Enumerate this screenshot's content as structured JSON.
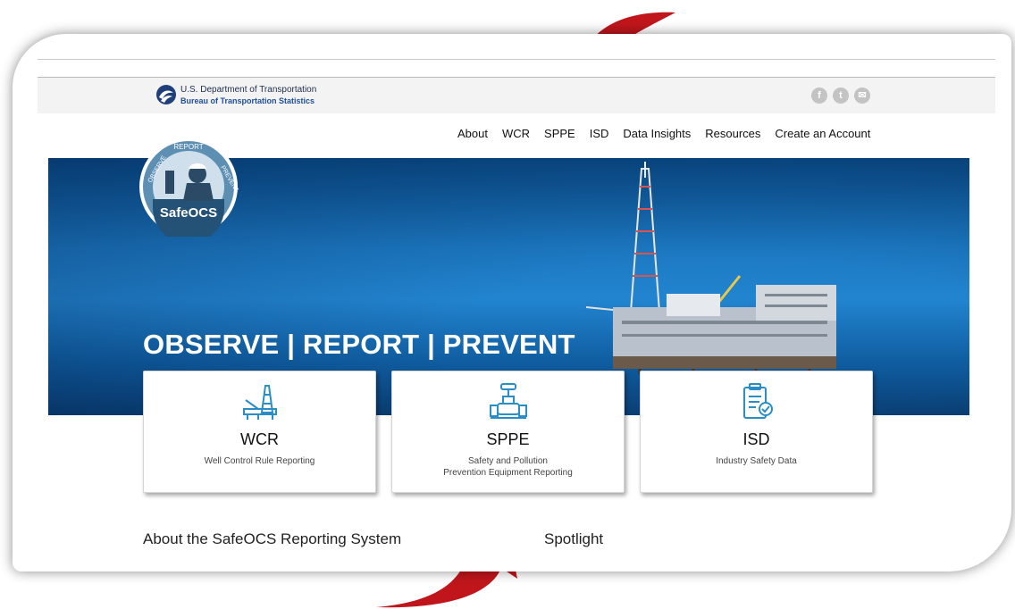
{
  "header": {
    "agency_line1": "U.S. Department of Transportation",
    "agency_line2": "Bureau of Transportation Statistics",
    "social_icons": [
      "facebook-icon",
      "twitter-icon",
      "email-icon"
    ]
  },
  "nav": {
    "items": [
      "About",
      "WCR",
      "SPPE",
      "ISD",
      "Data Insights",
      "Resources",
      "Create an Account"
    ]
  },
  "seal": {
    "top_text": "REPORT",
    "left_text": "OBSERVE",
    "right_text": "PREVENT",
    "name": "SafeOCS"
  },
  "hero": {
    "title": "OBSERVE | REPORT | PREVENT"
  },
  "cards": [
    {
      "title": "WCR",
      "desc_line1": "Well Control Rule Reporting",
      "desc_line2": "",
      "icon": "oil-rig-icon"
    },
    {
      "title": "SPPE",
      "desc_line1": "Safety and Pollution",
      "desc_line2": "Prevention Equipment Reporting",
      "icon": "valve-icon"
    },
    {
      "title": "ISD",
      "desc_line1": "Industry Safety Data",
      "desc_line2": "",
      "icon": "clipboard-check-icon"
    }
  ],
  "sections": {
    "about": "About the SafeOCS Reporting System",
    "spotlight": "Spotlight"
  },
  "colors": {
    "accent_arrow": "#c0161b",
    "hero_blue": "#1c79c2",
    "icon_blue": "#2a8ec6"
  }
}
